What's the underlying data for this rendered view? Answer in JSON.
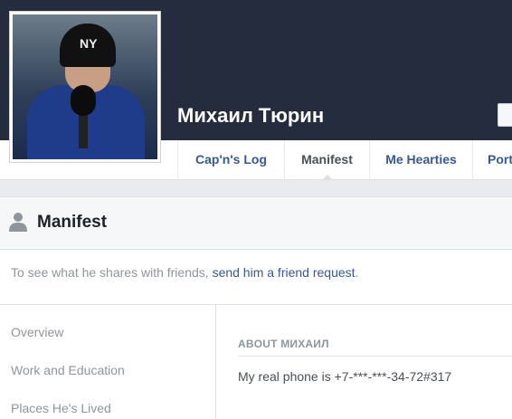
{
  "profile": {
    "name": "Михаил Тюрин",
    "hat_logo": "NY"
  },
  "tabs": [
    {
      "label": "Cap'n's Log",
      "active": false
    },
    {
      "label": "Manifest",
      "active": true
    },
    {
      "label": "Me Hearties",
      "active": false
    },
    {
      "label": "Port",
      "active": false
    }
  ],
  "panel": {
    "title": "Manifest",
    "notice_prefix": "To see what he shares with friends, ",
    "notice_link": "send him a friend request",
    "notice_suffix": "."
  },
  "sidenav": {
    "items": [
      "Overview",
      "Work and Education",
      "Places He's Lived"
    ]
  },
  "about": {
    "heading": "ABOUT МИХАИЛ",
    "text": "My real phone is +7-***-***-34-72#317"
  },
  "colors": {
    "cover": "#252c3d",
    "link": "#365899",
    "muted": "#90949c"
  }
}
